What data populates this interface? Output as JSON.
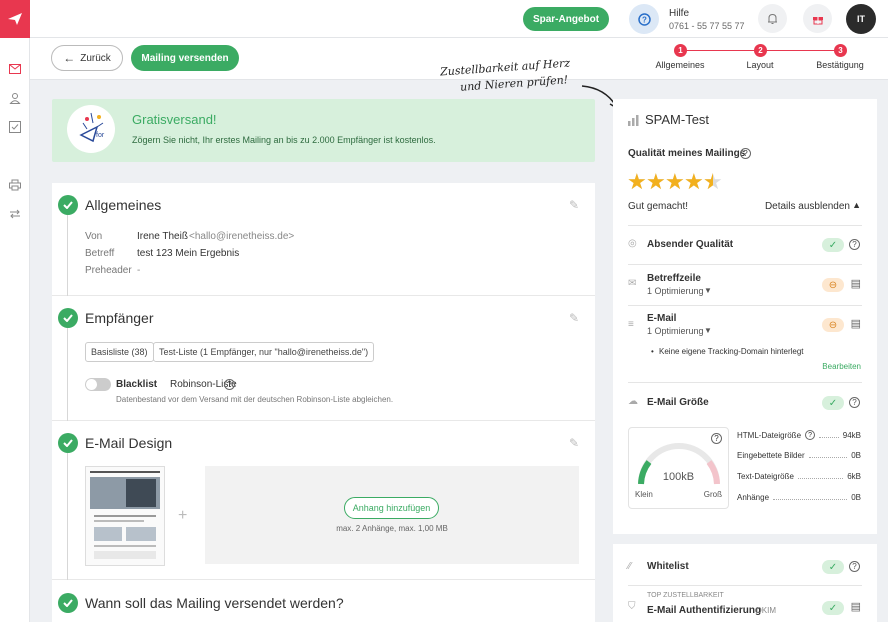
{
  "topbar": {
    "offer_button": "Spar-Angebot",
    "help_title": "Hilfe",
    "help_phone": "0761 - 55 77 55 77",
    "avatar_initials": "IT"
  },
  "subbar": {
    "back_label": "Zurück",
    "send_label": "Mailing versenden",
    "steps": [
      {
        "num": "1",
        "label": "Allgemeines"
      },
      {
        "num": "2",
        "label": "Layout"
      },
      {
        "num": "3",
        "label": "Bestätigung"
      }
    ],
    "annotation_line1": "Zustellbarkeit auf Herz",
    "annotation_line2": "und Nieren prüfen!"
  },
  "banner": {
    "title": "Gratisversand!",
    "text": "Zögern Sie nicht, Ihr erstes Mailing an bis zu 2.000 Empfänger ist kostenlos.",
    "badge_text": "for"
  },
  "general": {
    "title": "Allgemeines",
    "from_label": "Von",
    "from_name": "Irene Theiß",
    "from_email": "<hallo@irenetheiss.de>",
    "subject_label": "Betreff",
    "subject_value": "test 123 Mein Ergebnis",
    "preheader_label": "Preheader",
    "preheader_value": "-"
  },
  "recipients": {
    "title": "Empfänger",
    "tag1": "Basisliste (38)",
    "tag2": "Test-Liste (1 Empfänger, nur \"hallo@irenetheiss.de\")",
    "blacklist_bold": "Blacklist",
    "blacklist_rest": "Robinson-Liste",
    "blacklist_hint": "Datenbestand vor dem Versand mit der deutschen Robinson-Liste abgleichen."
  },
  "design": {
    "title": "E-Mail Design",
    "plus": "+",
    "attach_button": "Anhang hinzufügen",
    "attach_hint": "max. 2 Anhänge, max. 1,00 MB"
  },
  "schedule": {
    "title": "Wann soll das Mailing versendet werden?"
  },
  "spam": {
    "title": "SPAM-Test",
    "quality_label": "Qualität meines Mailings",
    "rating": 4.5,
    "rating_max": 5,
    "rating_text": "Gut gemacht!",
    "details_toggle": "Details ausblenden",
    "sender_quality": "Absender Qualität",
    "subject_line": "Betreffzeile",
    "subject_opt": "1 Optimierung",
    "email": "E-Mail",
    "email_opt": "1 Optimierung",
    "email_note": "Keine eigene Tracking-Domain hinterlegt",
    "edit_link": "Bearbeiten",
    "size_title": "E-Mail Größe",
    "gauge_value": "100kB",
    "gauge_min": "Klein",
    "gauge_max": "Groß",
    "size_rows": [
      {
        "label": "HTML-Dateigröße",
        "value": "94kB"
      },
      {
        "label": "Eingebettete Bilder",
        "value": "0B"
      },
      {
        "label": "Text-Dateigröße",
        "value": "6kB"
      },
      {
        "label": "Anhänge",
        "value": "0B"
      }
    ],
    "whitelist": "Whitelist",
    "top_label": "TOP ZUSTELLBARKEIT",
    "auth": "E-Mail Authentifizierung",
    "auth_suffix": "DKIM"
  },
  "colors": {
    "accent": "#e8374f",
    "green": "#3bab63",
    "banner_bg": "#d7f0dc",
    "star": "#f2b01e"
  }
}
